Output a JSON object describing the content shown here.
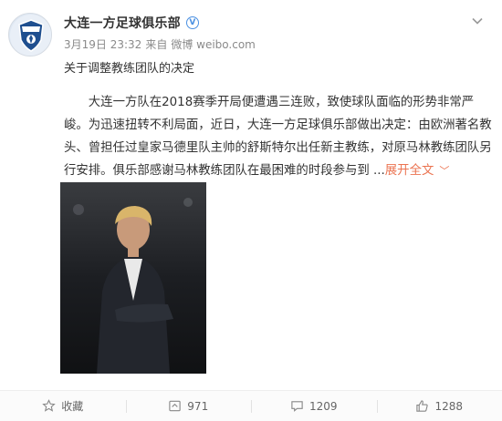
{
  "post": {
    "author": "大连一方足球俱乐部",
    "verified_mark": "V",
    "date": "3月19日 23:32",
    "source_prefix": "来自",
    "source": "微博 weibo.com",
    "subtitle": "关于调整教练团队的决定",
    "body": "大连一方队在2018赛季开局便遭遇三连败，致使球队面临的形势非常严峻。为迅速扭转不利局面，近日，大连一方足球俱乐部做出决定：由欧洲著名教头、曾担任过皇家马德里队主帅的舒斯特尔出任新主教练，对原马林教练团队另行安排。俱乐部感谢马林教练团队在最困难的时段参与到 ...",
    "expand_label": "展开全文",
    "expand_chevron": "﹀"
  },
  "actions": {
    "favorite_label": "收藏",
    "repost_count": "971",
    "comment_count": "1209",
    "like_count": "1288"
  },
  "colors": {
    "accent": "#eb7350",
    "verified": "#4a90e2",
    "text": "#333333",
    "muted": "#8a8a8a"
  },
  "icons": [
    "club-logo-icon",
    "verified-icon",
    "chevron-down-icon",
    "star-icon",
    "repost-icon",
    "comment-icon",
    "like-icon"
  ]
}
